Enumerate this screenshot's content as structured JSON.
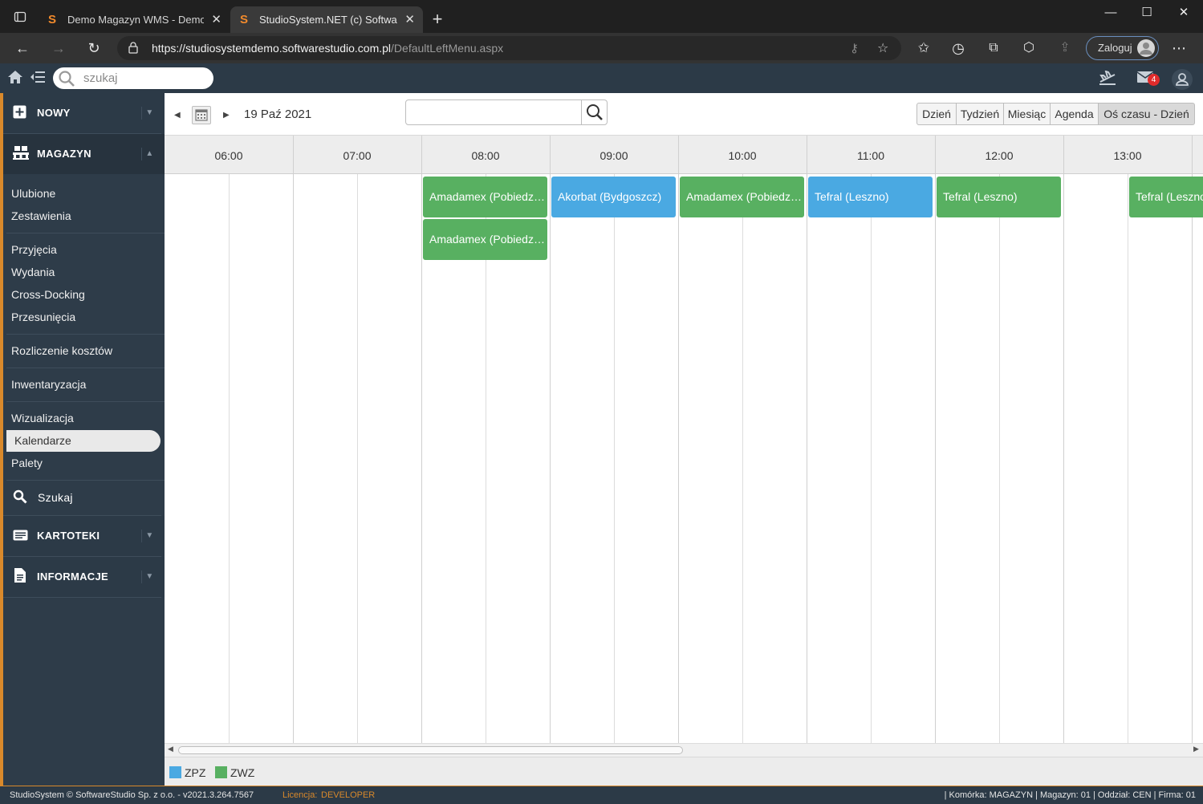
{
  "browser": {
    "tabs": [
      {
        "title": "Demo Magazyn WMS - Demo online"
      },
      {
        "title": "StudioSystem.NET (c) SoftwareStudio"
      }
    ],
    "url_host": "https://studiosystemdemo.softwarestudio.com.pl",
    "url_path": "/DefaultLeftMenu.aspx",
    "login_label": "Zaloguj"
  },
  "app": {
    "search_placeholder": "szukaj",
    "mail_badge": "4"
  },
  "sidebar": {
    "nowy": "NOWY",
    "magazyn": "MAGAZYN",
    "groups": [
      [
        "Ulubione",
        "Zestawienia"
      ],
      [
        "Przyjęcia",
        "Wydania",
        "Cross-Docking",
        "Przesunięcia"
      ],
      [
        "Rozliczenie kosztów"
      ],
      [
        "Inwentaryzacja"
      ],
      [
        "Wizualizacja",
        "Kalendarze",
        "Palety"
      ]
    ],
    "active_item": "Kalendarze",
    "szukaj": "Szukaj",
    "kartoteki": "KARTOTEKI",
    "informacje": "INFORMACJE"
  },
  "calendar": {
    "date": "19 Paź 2021",
    "search_value": "",
    "views": [
      "Dzień",
      "Tydzień",
      "Miesiąc",
      "Agenda",
      "Oś czasu - Dzień"
    ],
    "selected_view": "Oś czasu - Dzień",
    "hours": [
      "06:00",
      "07:00",
      "08:00",
      "09:00",
      "10:00",
      "11:00",
      "12:00",
      "13:00"
    ],
    "events": [
      {
        "label": "Amadamex (Pobiedziska)",
        "type": "ZWZ",
        "start": "08:00",
        "end": "09:00",
        "row": 0
      },
      {
        "label": "Amadamex (Pobiedziska)",
        "type": "ZWZ",
        "start": "08:00",
        "end": "09:00",
        "row": 1
      },
      {
        "label": "Akorbat (Bydgoszcz)",
        "type": "ZPZ",
        "start": "09:00",
        "end": "10:00",
        "row": 0
      },
      {
        "label": "Amadamex (Pobiedziska)",
        "type": "ZWZ",
        "start": "10:00",
        "end": "11:00",
        "row": 0
      },
      {
        "label": "Tefral (Leszno)",
        "type": "ZPZ",
        "start": "11:00",
        "end": "12:00",
        "row": 0
      },
      {
        "label": "Tefral (Leszno)",
        "type": "ZWZ",
        "start": "12:00",
        "end": "13:00",
        "row": 0
      },
      {
        "label": "Tefral (Leszno)",
        "type": "ZWZ",
        "start": "13:30",
        "end": "14:30",
        "row": 0
      }
    ],
    "legend": [
      {
        "label": "ZPZ",
        "color": "#4aa9e2"
      },
      {
        "label": "ZWZ",
        "color": "#58b061"
      }
    ]
  },
  "footer": {
    "copyright": "StudioSystem © SoftwareStudio Sp. z o.o. - v2021.3.264.7567",
    "license_label": "Licencja:",
    "license_value": "DEVELOPER",
    "context": "| Komórka: MAGAZYN | Magazyn: 01 | Oddział: CEN | Firma: 01"
  }
}
